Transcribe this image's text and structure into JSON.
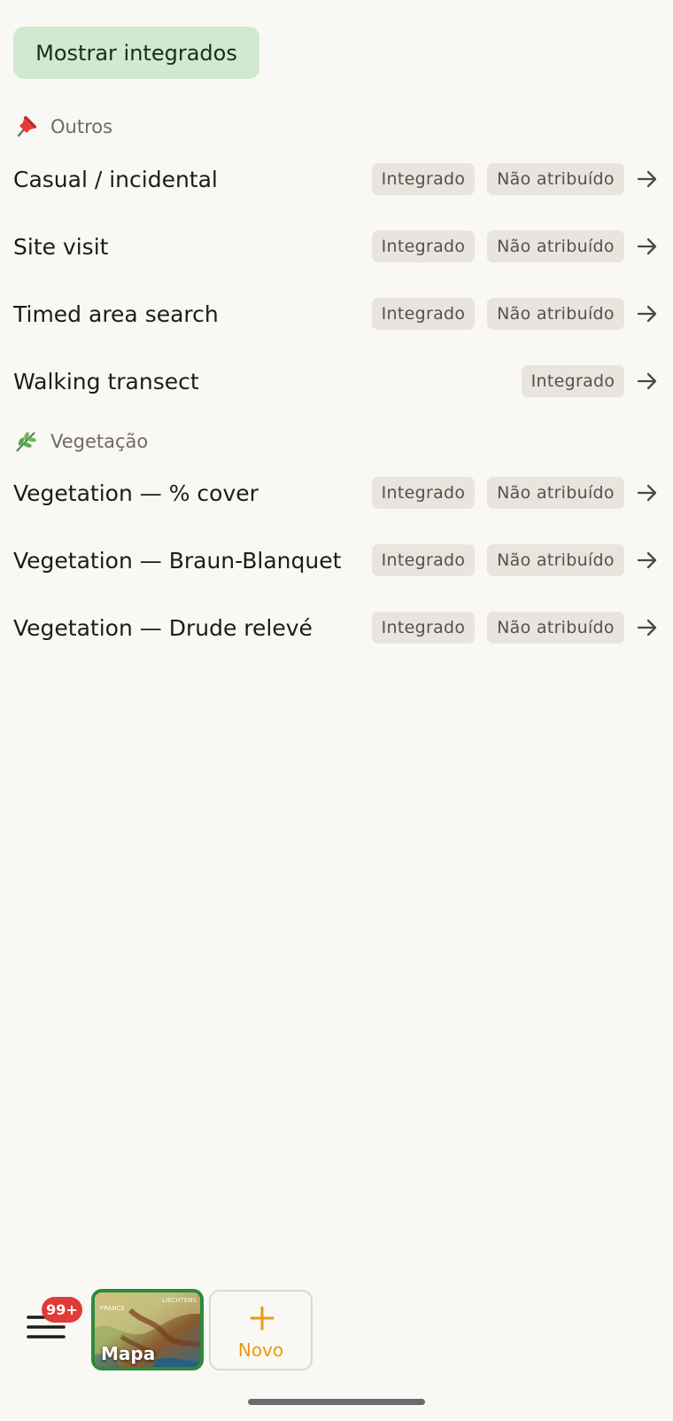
{
  "toolbar": {
    "toggle_label": "Mostrar integrados"
  },
  "sections": [
    {
      "icon": "pushpin-icon",
      "label": "Outros",
      "items": [
        {
          "title": "Casual / incidental",
          "chips": [
            "Integrado",
            "Não atribuído"
          ]
        },
        {
          "title": "Site visit",
          "chips": [
            "Integrado",
            "Não atribuído"
          ]
        },
        {
          "title": "Timed area search",
          "chips": [
            "Integrado",
            "Não atribuído"
          ]
        },
        {
          "title": "Walking transect",
          "chips": [
            "Integrado"
          ]
        }
      ]
    },
    {
      "icon": "herb-icon",
      "label": "Vegetação",
      "items": [
        {
          "title": "Vegetation — % cover",
          "chips": [
            "Integrado",
            "Não atribuído"
          ]
        },
        {
          "title": "Vegetation — Braun-Blanquet",
          "chips": [
            "Integrado",
            "Não atribuído"
          ]
        },
        {
          "title": "Vegetation — Drude relevé",
          "chips": [
            "Integrado",
            "Não atribuído"
          ]
        }
      ]
    }
  ],
  "bottom_bar": {
    "menu_icon": "hamburger-menu-icon",
    "badge": "99+",
    "map_label": "Mapa",
    "map_text": [
      "FRANCE",
      "LIECHTENS"
    ],
    "new_label": "Novo",
    "new_icon": "plus-icon"
  },
  "colors": {
    "background": "#faf8f5",
    "toggle_bg": "#d0e9cf",
    "chip_bg": "#e8e5de",
    "badge": "#e03b36",
    "map_border": "#2e8a3b",
    "new_accent": "#ec9a0c"
  }
}
